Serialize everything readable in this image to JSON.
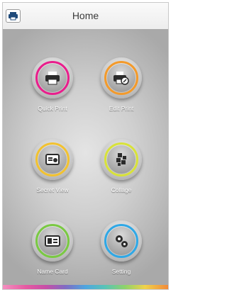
{
  "header": {
    "title": "Home",
    "printer_icon": "printer-icon"
  },
  "menu": [
    {
      "label": "Quick Print",
      "icon": "printer-icon",
      "ring_color": "#e91e8c"
    },
    {
      "label": "Edit Print",
      "icon": "edit-printer-icon",
      "ring_color": "#f39a2b"
    },
    {
      "label": "Secret View",
      "icon": "secret-view-icon",
      "ring_color": "#f2c230"
    },
    {
      "label": "Collage",
      "icon": "collage-icon",
      "ring_color": "#d8e23a"
    },
    {
      "label": "Name Card",
      "icon": "name-card-icon",
      "ring_color": "#7ac943"
    },
    {
      "label": "Setting",
      "icon": "gear-icon",
      "ring_color": "#2fa8e6"
    }
  ]
}
